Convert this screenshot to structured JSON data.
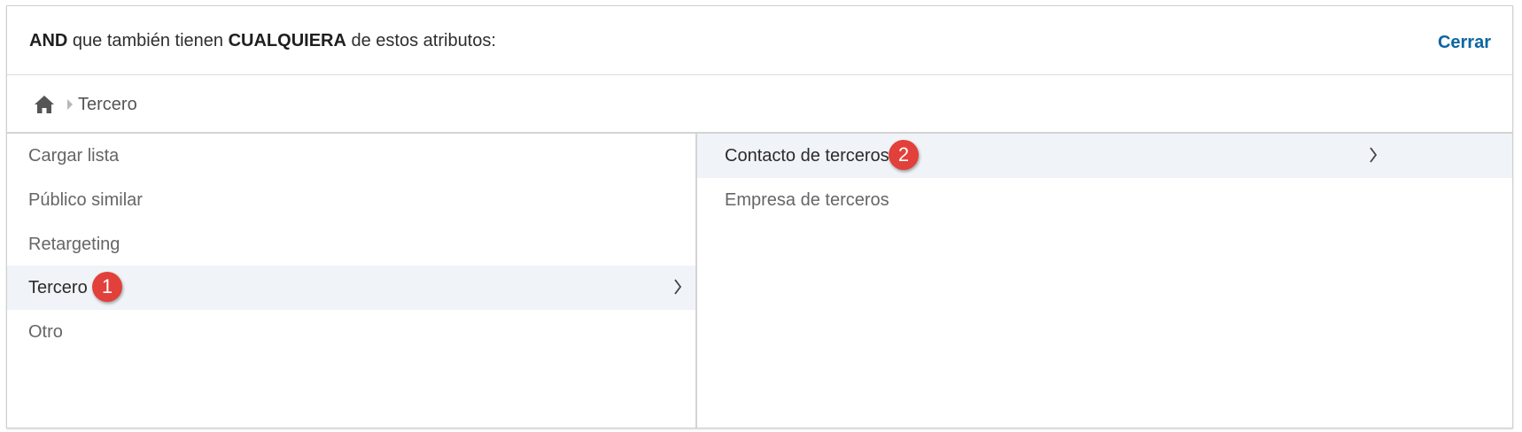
{
  "header": {
    "title_part1": "AND",
    "title_part2": " que también tienen ",
    "title_part3": "CUALQUIERA",
    "title_part4": " de estos atributos:",
    "close_label": "Cerrar"
  },
  "breadcrumb": {
    "home_icon": "home-icon",
    "items": [
      {
        "label": "Tercero"
      }
    ]
  },
  "left_list": {
    "items": [
      {
        "label": "Cargar lista",
        "selected": false
      },
      {
        "label": "Público similar",
        "selected": false
      },
      {
        "label": "Retargeting",
        "selected": false
      },
      {
        "label": "Tercero",
        "selected": true,
        "badge": "1"
      },
      {
        "label": "Otro",
        "selected": false
      }
    ]
  },
  "right_list": {
    "items": [
      {
        "label": "Contacto de terceros",
        "selected": true,
        "badge": "2"
      },
      {
        "label": "Empresa de terceros",
        "selected": false
      }
    ]
  },
  "colors": {
    "accent": "#0a66a2",
    "badge": "#e2403a",
    "selected_bg": "#f0f3f7"
  }
}
